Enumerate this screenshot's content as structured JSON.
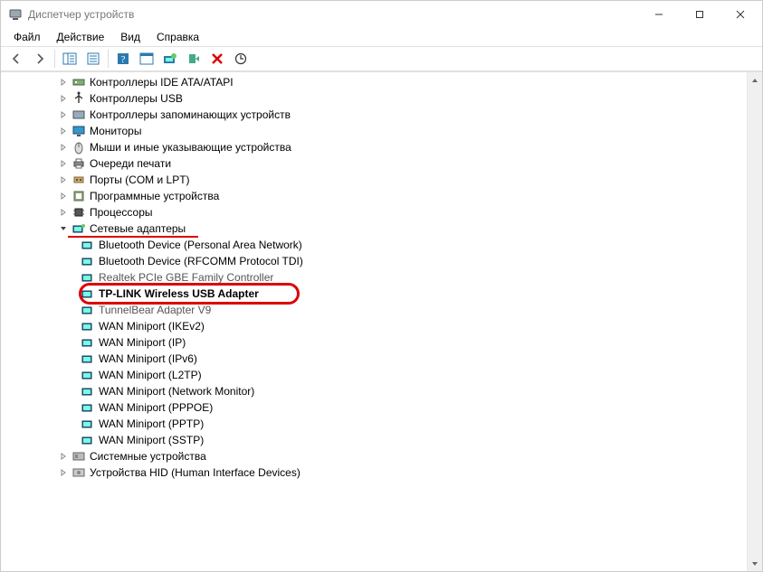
{
  "window": {
    "title": "Диспетчер устройств"
  },
  "menu": {
    "file": "Файл",
    "action": "Действие",
    "view": "Вид",
    "help": "Справка"
  },
  "tree": {
    "cat_ide": "Контроллеры IDE ATA/ATAPI",
    "cat_usb": "Контроллеры USB",
    "cat_storage": "Контроллеры запоминающих устройств",
    "cat_monitors": "Мониторы",
    "cat_mice": "Мыши и иные указывающие устройства",
    "cat_print": "Очереди печати",
    "cat_ports": "Порты (COM и LPT)",
    "cat_software": "Программные устройства",
    "cat_cpu": "Процессоры",
    "cat_net": "Сетевые адаптеры",
    "net_bt_pan": "Bluetooth Device (Personal Area Network)",
    "net_bt_rfcomm": "Bluetooth Device (RFCOMM Protocol TDI)",
    "net_realtek": "Realtek PCIe GBE Family Controller",
    "net_tplink": "TP-LINK Wireless USB Adapter",
    "net_tunnelbear": "TunnelBear Adapter V9",
    "net_wan_ikev2": "WAN Miniport (IKEv2)",
    "net_wan_ip": "WAN Miniport (IP)",
    "net_wan_ipv6": "WAN Miniport (IPv6)",
    "net_wan_l2tp": "WAN Miniport (L2TP)",
    "net_wan_netmon": "WAN Miniport (Network Monitor)",
    "net_wan_pppoe": "WAN Miniport (PPPOE)",
    "net_wan_pptp": "WAN Miniport (PPTP)",
    "net_wan_sstp": "WAN Miniport (SSTP)",
    "cat_system": "Системные устройства",
    "cat_hid": "Устройства HID (Human Interface Devices)"
  }
}
